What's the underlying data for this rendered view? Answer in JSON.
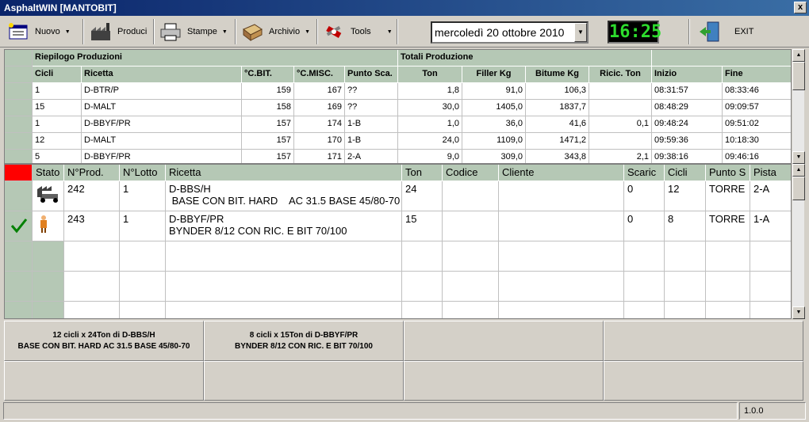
{
  "window": {
    "title": "AsphaltWIN  [MANTOBIT]",
    "close": "x"
  },
  "toolbar": {
    "nuovo": "Nuovo",
    "produci": "Produci",
    "stampe": "Stampe",
    "archivio": "Archivio",
    "tools": "Tools",
    "exit": "EXIT",
    "date": "mercoledì 20   ottobre   2010",
    "clock": "16:25"
  },
  "summary": {
    "section_left": "Riepilogo Produzioni",
    "section_right": "Totali  Produzione",
    "headers": [
      "Cicli",
      "Ricetta",
      "°C.BIT.",
      "°C.MISC.",
      "Punto Sca.",
      "Ton",
      "Filler Kg",
      "Bitume Kg",
      "Ricic. Ton",
      "Inizio",
      "Fine"
    ],
    "rows": [
      [
        "1",
        "D-BTR/P",
        "159",
        "167",
        "??",
        "1,8",
        "91,0",
        "106,3",
        "",
        "08:31:57",
        "08:33:46"
      ],
      [
        "15",
        "D-MALT",
        "158",
        "169",
        "??",
        "30,0",
        "1405,0",
        "1837,7",
        "",
        "08:48:29",
        "09:09:57"
      ],
      [
        "1",
        "D-BBYF/PR",
        "157",
        "174",
        "1-B",
        "1,0",
        "36,0",
        "41,6",
        "0,1",
        "09:48:24",
        "09:51:02"
      ],
      [
        "12",
        "D-MALT",
        "157",
        "170",
        "1-B",
        "24,0",
        "1109,0",
        "1471,2",
        "",
        "09:59:36",
        "10:18:30"
      ],
      [
        "5",
        "D-BBYF/PR",
        "157",
        "171",
        "2-A",
        "9,0",
        "309,0",
        "343,8",
        "2,1",
        "09:38:16",
        "09:46:16"
      ]
    ]
  },
  "orders": {
    "headers": [
      "Stato",
      "N°Prod.",
      "N°Lotto",
      "Ricetta",
      "Ton",
      "Codice",
      "Cliente",
      "Scaric",
      "Cicli",
      "Punto S",
      "Pista"
    ],
    "rows": [
      {
        "prod": "242",
        "lotto": "1",
        "ricetta": "D-BBS/H",
        "desc": " BASE CON BIT. HARD    AC 31.5 BASE 45/80-70",
        "ton": "24",
        "codice": "",
        "cliente": "",
        "scaric": "0",
        "cicli": "12",
        "punto": "TORRE",
        "pista": "2-A",
        "state_icon": "conveyor-icon"
      },
      {
        "prod": "243",
        "lotto": "1",
        "ricetta": "D-BBYF/PR",
        "desc": "BYNDER 8/12 CON RIC. E BIT 70/100",
        "ton": "15",
        "codice": "",
        "cliente": "",
        "scaric": "0",
        "cicli": "8",
        "punto": "TORRE",
        "pista": "1-A",
        "state_icon": "person-icon"
      }
    ]
  },
  "panels": {
    "p1": "12 cicli x 24Ton  di D-BBS/H\nBASE CON BIT. HARD    AC 31.5 BASE 45/80-70",
    "p2": "8 cicli x 15Ton  di D-BBYF/PR\nBYNDER 8/12 CON RIC. E BIT 70/100"
  },
  "status": {
    "version": "1.0.0"
  },
  "colors": {
    "grid_header": "#b5c8b5",
    "alert": "#ff0000",
    "clock": "#2ddc2d"
  }
}
